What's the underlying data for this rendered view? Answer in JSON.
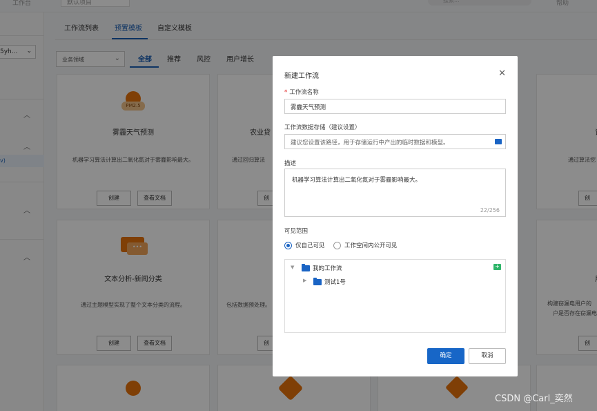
{
  "topbar": {
    "crumb": "工作台",
    "project": "默认项目",
    "search_placeholder": "搜索...",
    "help": "帮助"
  },
  "sidebar": {
    "workspace": "5yh...",
    "active_item": "v)"
  },
  "tabs": [
    {
      "label": "工作流列表"
    },
    {
      "label": "预置模板"
    },
    {
      "label": "自定义模板"
    }
  ],
  "filter": {
    "placeholder": "业务领域"
  },
  "categories": [
    "全部",
    "推荐",
    "风控",
    "用户增长"
  ],
  "cards": {
    "haze": {
      "title": "雾霾天气预测",
      "desc": "机器学习算法计算出二氧化氮对于雾霾影响最大。",
      "icon_text": "PM2.5"
    },
    "agri": {
      "title": "农业贷",
      "desc": "通过回归算法"
    },
    "text": {
      "title": "文本分析-新闻分类",
      "desc": "通过主题模型实现了整个文本分类的流程。"
    },
    "data": {
      "desc": "包括数据预处理。"
    },
    "right1": {
      "title": "记",
      "desc": "通过算法挖"
    },
    "right2": {
      "title": "用",
      "desc1": "构建窃漏电用户的",
      "desc2": "户是否存在窃漏电"
    },
    "create_label": "创建",
    "doc_label": "查看文档",
    "create_short": "创"
  },
  "modal": {
    "title": "新建工作流",
    "name_label": "工作流名称",
    "name_value": "雾霾天气预测",
    "storage_label": "工作流数据存储（建议设置）",
    "storage_placeholder": "建议您设置该路径，用于存储运行中产出的临时数据和模型。",
    "desc_label": "描述",
    "desc_value": "机器学习算法计算出二氧化氮对于雾霾影响最大。",
    "desc_count": "22/256",
    "visibility_label": "可见范围",
    "radio_private": "仅自己可见",
    "radio_public": "工作空间内公开可见",
    "tree_root": "我的工作流",
    "tree_child": "测试1号",
    "ok_label": "确定",
    "cancel_label": "取消"
  },
  "watermark": "CSDN @Carl_奕然",
  "colors": {
    "primary": "#1766c7",
    "accent_orange": "#e8730c",
    "add_folder_green": "#2fb56a"
  }
}
